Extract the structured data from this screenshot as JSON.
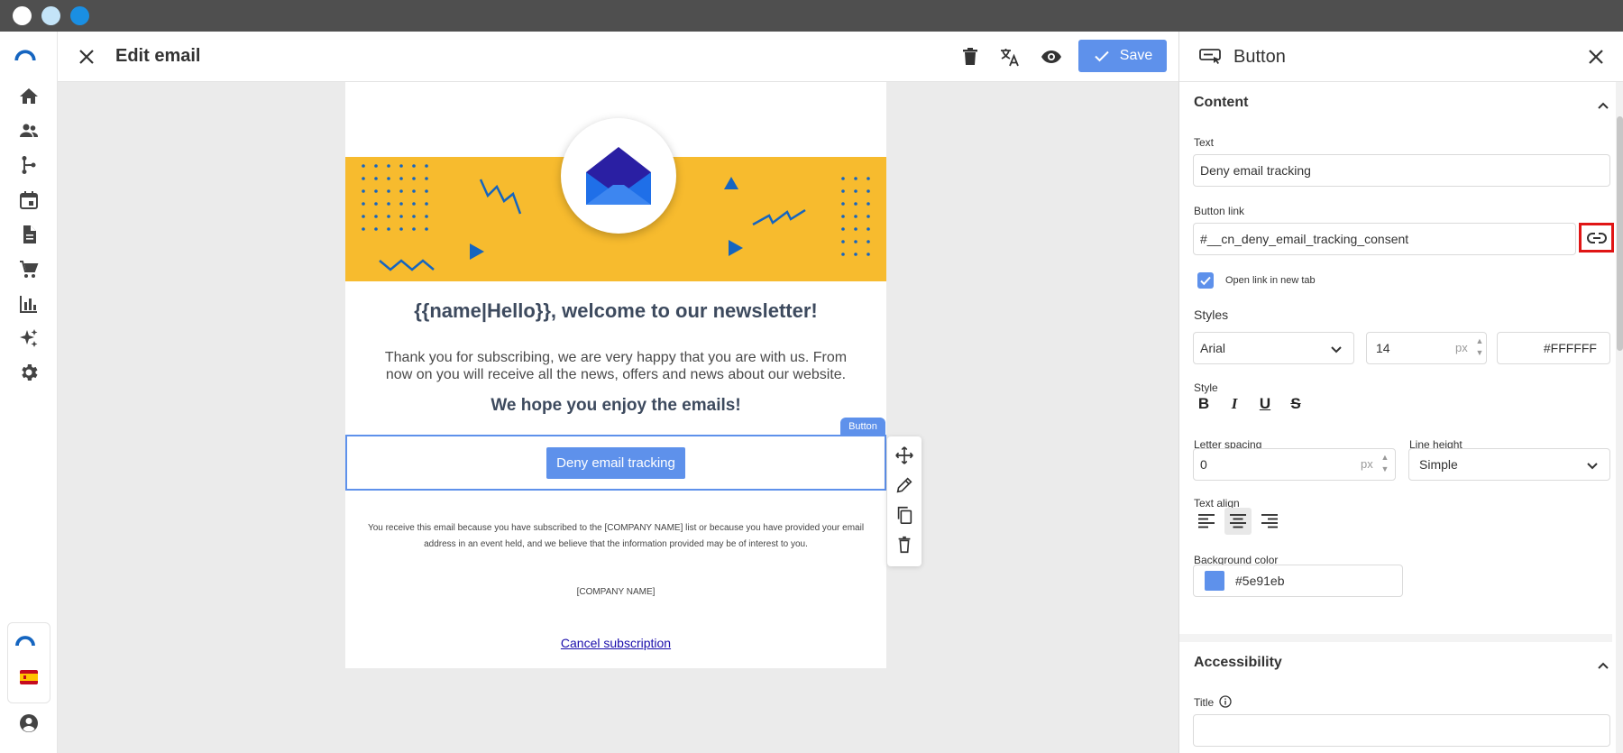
{
  "titlebar": {
    "dot_colors": [
      "#ffffff",
      "#c4e4f8",
      "#1a8fe3"
    ]
  },
  "topbar": {
    "title": "Edit email",
    "save_label": "Save"
  },
  "email": {
    "heading": "{{name|Hello}}, welcome to our newsletter!",
    "paragraph": "Thank you for subscribing, we are very happy that you are with us. From now on you will receive all the news, offers and news about our website.",
    "subheading": "We hope you enjoy the emails!",
    "selected_tag": "Button",
    "button_label": "Deny email tracking",
    "footer_text": "You receive this email because you have subscribed to the [COMPANY NAME] list or because you have provided your email address in an event held, and we believe that the information provided may be of interest to you.",
    "company": "[COMPANY NAME]",
    "cancel_link": "Cancel subscription"
  },
  "panel": {
    "title": "Button",
    "content_section": "Content",
    "text_label": "Text",
    "text_value": "Deny email tracking",
    "link_label": "Button link",
    "link_value": "#__cn_deny_email_tracking_consent",
    "new_tab_label": "Open link in new tab",
    "new_tab_checked": true,
    "styles_heading": "Styles",
    "font_value": "Arial",
    "font_size_value": "14",
    "font_size_unit": "px",
    "text_color_value": "#FFFFFF",
    "style_label": "Style",
    "letter_spacing_label": "Letter spacing",
    "letter_spacing_value": "0",
    "letter_spacing_unit": "px",
    "line_height_label": "Line height",
    "line_height_value": "Simple",
    "text_align_label": "Text align",
    "text_align_selected": "center",
    "bg_color_label": "Background color",
    "bg_color_value": "#5e91eb",
    "accessibility_section": "Accessibility",
    "title_label": "Title"
  },
  "colors": {
    "accent": "#5e91eb",
    "hero": "#f7bb2e",
    "highlight": "#e01515"
  }
}
